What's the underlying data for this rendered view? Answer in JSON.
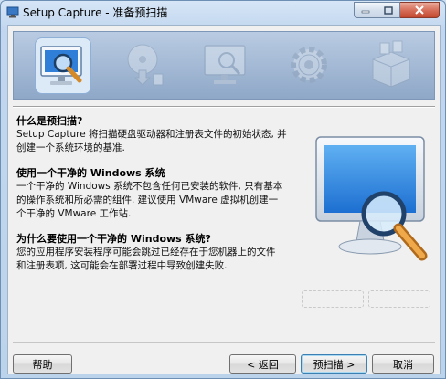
{
  "window": {
    "title": "Setup Capture - 准备预扫描"
  },
  "sections": [
    {
      "heading": "什么是预扫描?",
      "lines": [
        "Setup Capture 将扫描硬盘驱动器和注册表文件的初始状态, 并",
        "创建一个系统环境的基准."
      ]
    },
    {
      "heading": "使用一个干净的 Windows 系统",
      "lines": [
        "一个干净的 Windows 系统不包含任何已安装的软件, 只有基本",
        "的操作系统和所必需的组件. 建议使用 VMware 虚拟机创建一",
        "个干净的 VMware 工作站."
      ]
    },
    {
      "heading": "为什么要使用一个干净的 Windows 系统?",
      "lines": [
        "您的应用程序安装程序可能会跳过已经存在于您机器上的文件",
        "和注册表项, 这可能会在部署过程中导致创建失败."
      ]
    }
  ],
  "buttons": {
    "help": "帮助",
    "back": "< 返回",
    "prescan": "预扫描 >",
    "cancel": "取消"
  },
  "wizard_steps": [
    "monitor-search-icon",
    "disc-install-icon",
    "monitor-icon",
    "gear-icon",
    "package-icon"
  ],
  "colors": {
    "accent": "#3c7fb1",
    "banner": "#9fb6d3"
  }
}
